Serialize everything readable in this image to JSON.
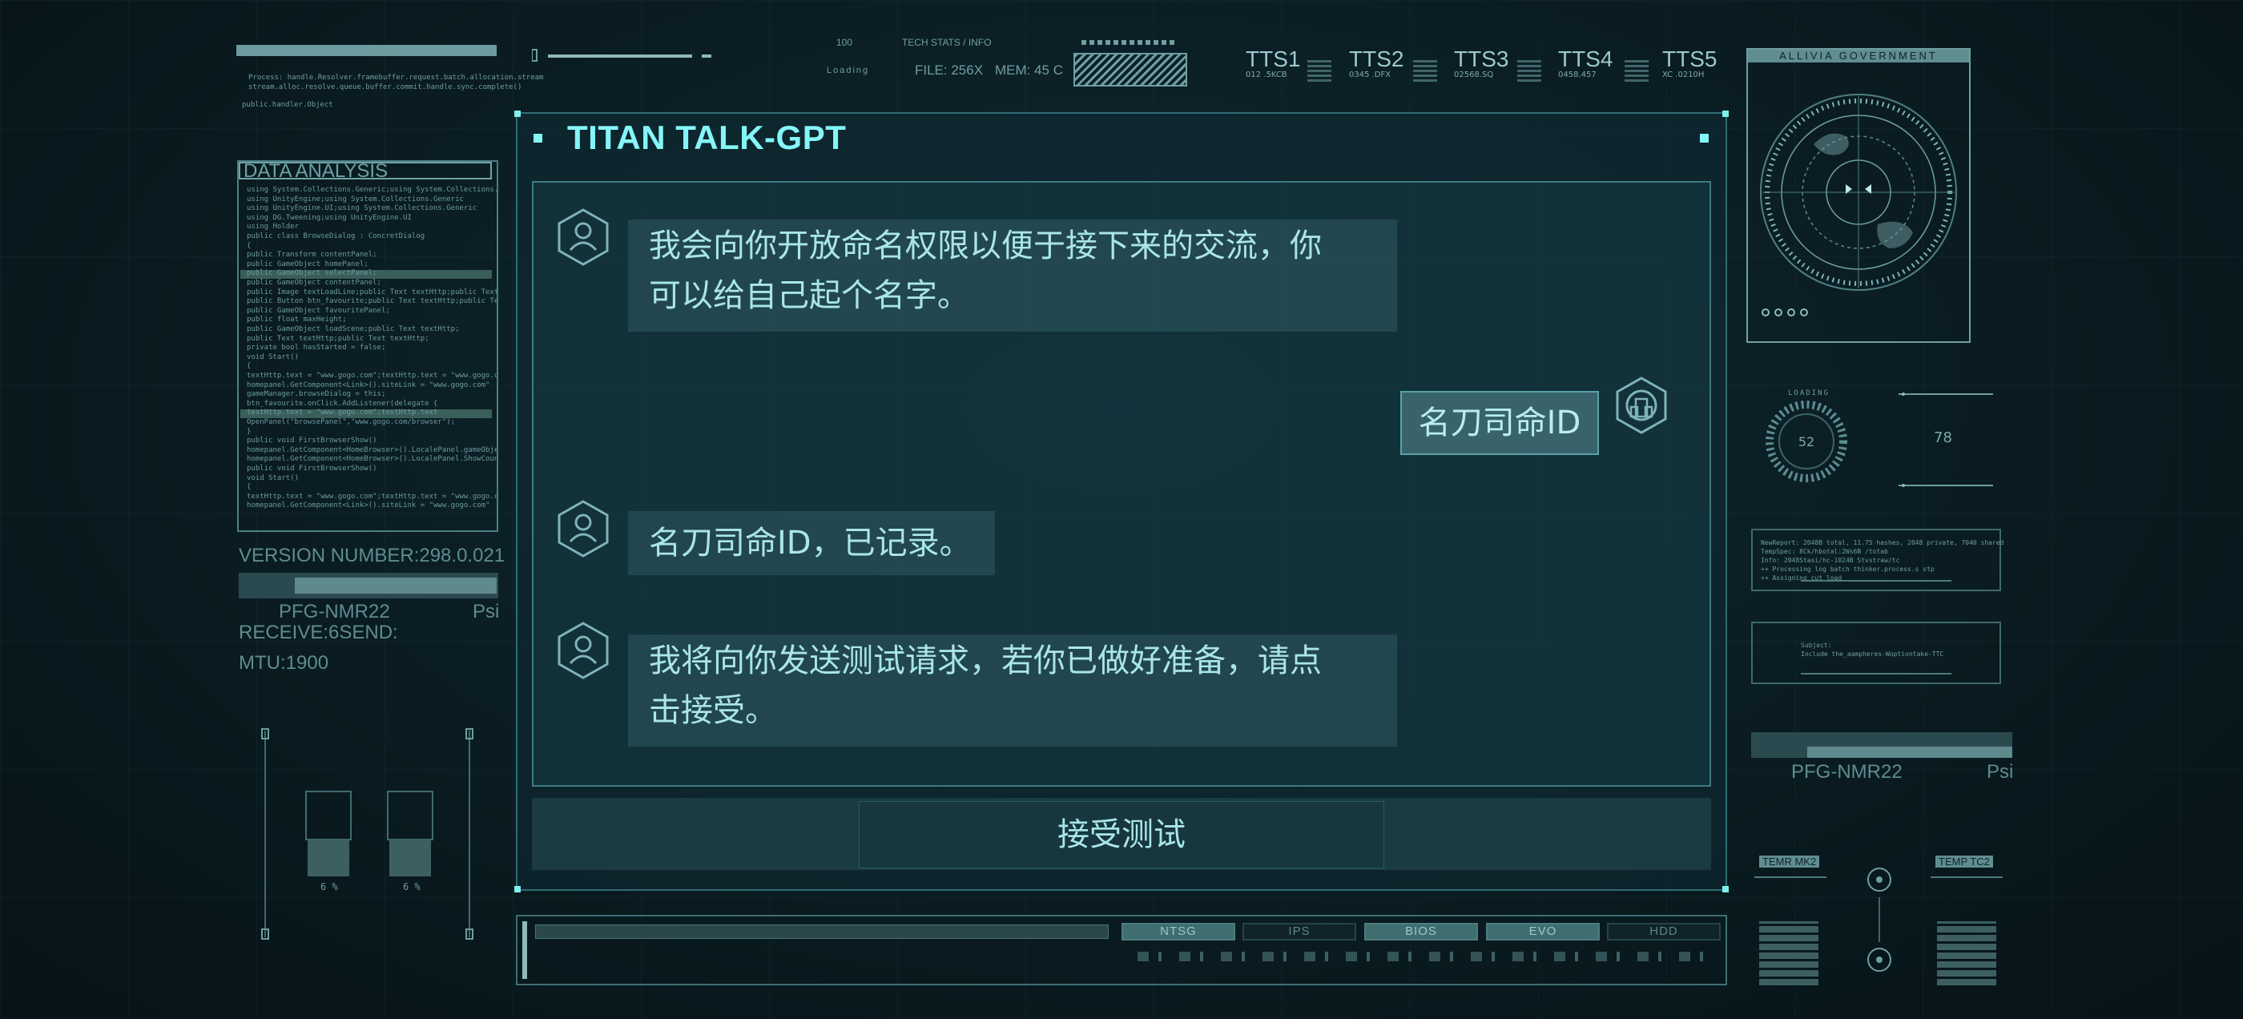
{
  "window": {
    "title": "TITAN TALK-GPT",
    "accent": "#84f6f8"
  },
  "chat": {
    "messages": [
      {
        "role": "bot",
        "text_line1": "我会向你开放命名权限以便于接下来的交流，你",
        "text_line2": "可以给自己起个名字。"
      },
      {
        "role": "user",
        "text": "名刀司命ID"
      },
      {
        "role": "bot",
        "text": "名刀司命ID，已记录。"
      },
      {
        "role": "bot",
        "text_line1": "我将向你发送测试请求，若你已做好准备，请点",
        "text_line2": "击接受。"
      }
    ],
    "accept_label": "接受测试"
  },
  "left_panel": {
    "data_analysis_title": "DATA ANALYSIS",
    "code_lines": [
      "using System.Collections.Generic;using System.Collections.Generic",
      "using UnityEngine;using System.Collections.Generic",
      "using UnityEngine.UI;using System.Collections.Generic",
      "using DG.Tweening;using UnityEngine.UI",
      "using Holder",
      "public class BrowseDialog : ConcretDialog",
      "{",
      "  public Transform contentPanel;",
      "  public GameObject homePanel;",
      "  public GameObject selectPanel;",
      "  public GameObject contentPanel;",
      "  public Image textLoadLine;public Text textHttp;public Text tHttp",
      "  public Button btn_favourite;public Text textHttp;public Text textHttp",
      "  public GameObject favouritePanel;",
      "  public float maxHeight;",
      "  public GameObject loadScene;public Text textHttp;",
      "  public Text textHttp;public Text textHttp;",
      "  private bool hasStarted = false;",
      "  void Start()",
      "  {",
      "    textHttp.text = \"www.gogo.com\";textHttp.text = \"www.gogo.com\"",
      "    homepanel.GetComponent<Link>().siteLink = \"www.gogo.com\"",
      "    gameManager.browseDialog = this;",
      "    btn_favourite.onClick.AddListener(delegate {",
      "    textHttp.text = \"www.gogo.com\";textHttp.text",
      "    OpenPanel(\"browsePanel\",\"www.gogo.com/browser\");",
      "  }",
      "  public void FirstBrowserShow()",
      "  homepanel.GetComponent<HomeBrowser>().LocalePanel.gameObject",
      "  homepanel.GetComponent<HomeBrowser>().LocalePanel.ShowCoun",
      "  public void FirstBrowserShow()",
      "  void Start()",
      "  {",
      "    textHttp.text = \"www.gogo.com\";textHttp.text = \"www.gogo.com\"",
      "    homepanel.GetComponent<Link>().siteLink = \"www.gogo.com\""
    ],
    "version": "VERSION NUMBER:298.0.021",
    "pfg": "PFG-NMR22",
    "psi": "Psi",
    "receive": "RECEIVE:6SEND:",
    "mtu": "MTU:1900",
    "slider_pct_a": "6 %",
    "slider_pct_b": "6 %"
  },
  "top_header": {
    "progress_value": "100",
    "loading": "Loading",
    "tech_stats": "TECH STATS / INFO",
    "file": "FILE: 256X",
    "mem": "MEM: 45 C",
    "tts": [
      {
        "name": "TTS1",
        "sub": "012 .5KCB"
      },
      {
        "name": "TTS2",
        "sub": "0345 .DFX"
      },
      {
        "name": "TTS3",
        "sub": "02568.SQ"
      },
      {
        "name": "TTS4",
        "sub": "0458.457"
      },
      {
        "name": "TTS5",
        "sub": "XC .0210H"
      }
    ]
  },
  "right_panel": {
    "radar_title": "ALLIVIA GOVERNMENT",
    "dial_value": "52",
    "dial_label": "LOADING",
    "readout_value": "78",
    "pfg": "PFG-NMR22",
    "psi": "Psi",
    "temp_a": "TEMR MK2",
    "temp_b": "TEMP TC2"
  },
  "bottom_bar": {
    "progress": 0.0,
    "chips": [
      {
        "label": "NTSG",
        "state": "on"
      },
      {
        "label": "IPS",
        "state": "off"
      },
      {
        "label": "BIOS",
        "state": "on"
      },
      {
        "label": "EVO",
        "state": "on"
      },
      {
        "label": "HDD",
        "state": "off"
      }
    ]
  }
}
